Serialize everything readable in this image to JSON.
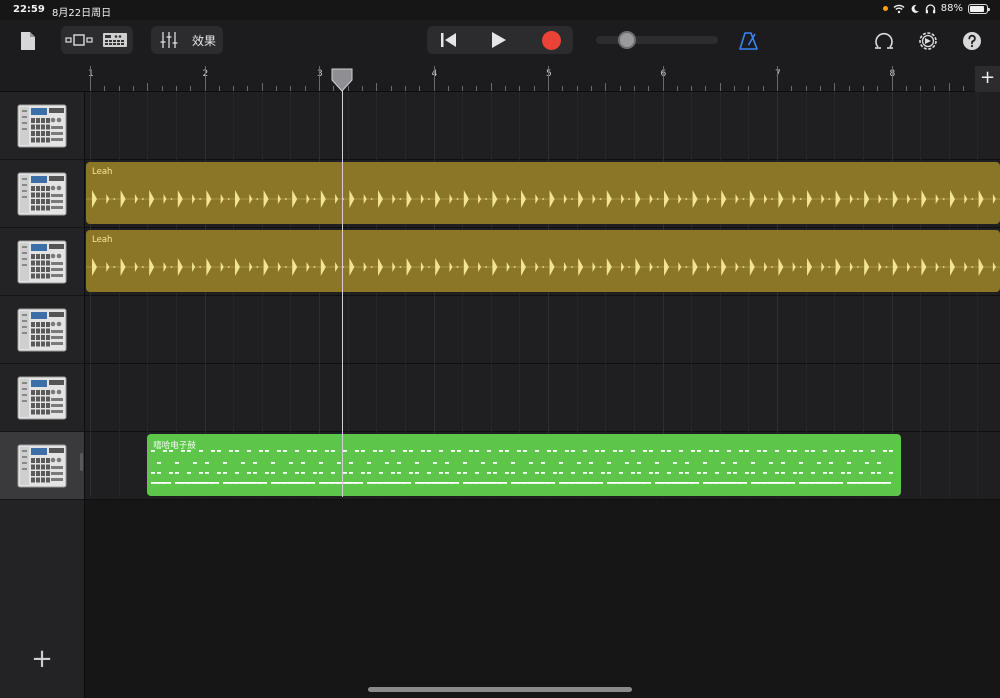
{
  "status_bar": {
    "time": "22:59",
    "date": "8月22日周日",
    "battery": "88%",
    "battery_level": 0.88,
    "icons": [
      "wifi-icon",
      "moon-icon",
      "headphones-icon",
      "battery-icon"
    ]
  },
  "toolbar": {
    "effects_label": "效果",
    "icons": {
      "browser": "document-icon",
      "view_toggle": "tracks-view-icon",
      "mixer": "mixer-sliders-icon",
      "go_to_start": "go-to-beginning-icon",
      "play": "play-icon",
      "record": "record-icon",
      "metronome": "metronome-icon",
      "loop": "loop-icon",
      "settings": "settings-gear-icon",
      "help": "help-icon"
    },
    "master_volume": 0.18,
    "colors": {
      "record": "#ea4335",
      "metronome": "#3a83f6"
    }
  },
  "ruler": {
    "bars": [
      "1",
      "2",
      "3",
      "4",
      "5",
      "6",
      "7",
      "8"
    ],
    "add_label": "+"
  },
  "tracks": [
    {
      "instrument": "drum-machine-icon",
      "selected": false,
      "region": null
    },
    {
      "instrument": "drum-machine-icon",
      "selected": false,
      "region": {
        "label": "Leah",
        "type": "audio"
      }
    },
    {
      "instrument": "drum-machine-icon",
      "selected": false,
      "region": {
        "label": "Leah",
        "type": "audio"
      }
    },
    {
      "instrument": "drum-machine-icon",
      "selected": false,
      "region": null
    },
    {
      "instrument": "drum-machine-icon",
      "selected": false,
      "region": null
    },
    {
      "instrument": "drum-machine-icon",
      "selected": true,
      "region": {
        "label": "嘻哈电子鼓",
        "type": "midi"
      }
    }
  ],
  "add_track_label": "+",
  "colors": {
    "audio_region": "#8b7628",
    "midi_region": "#5cc54a",
    "selected_track": "#3a3a3c"
  }
}
